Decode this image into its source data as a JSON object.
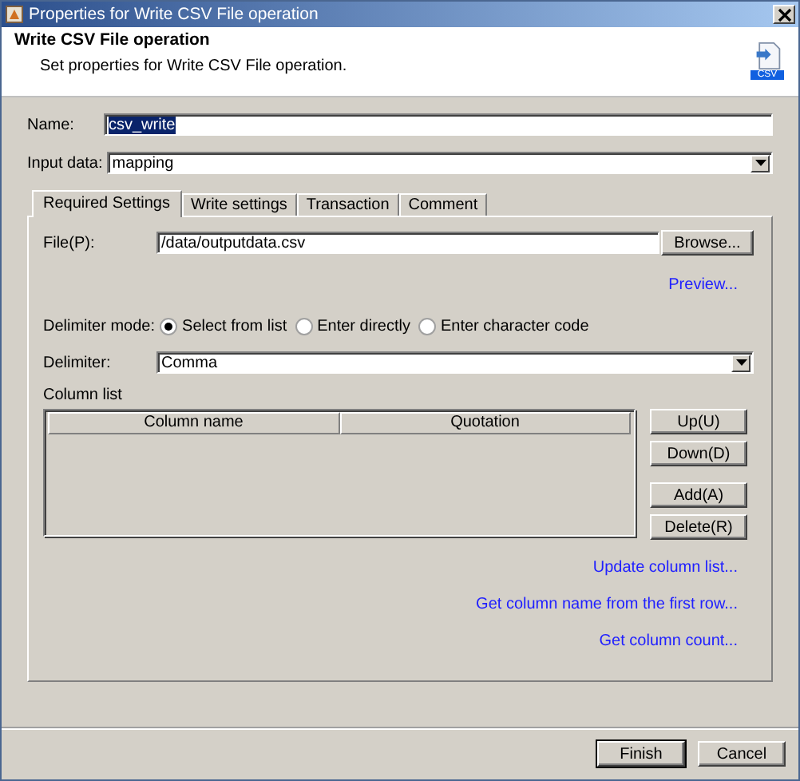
{
  "window": {
    "title": "Properties for Write CSV File operation"
  },
  "header": {
    "title": "Write CSV File operation",
    "description": "Set properties for Write CSV File operation.",
    "icon_label": "CSV"
  },
  "name_field": {
    "label": "Name:",
    "value": "csv_write",
    "text_selected": true
  },
  "input_data": {
    "label": "Input data:",
    "value": "mapping"
  },
  "tabs": [
    {
      "label": "Required Settings",
      "selected": true
    },
    {
      "label": "Write settings",
      "selected": false
    },
    {
      "label": "Transaction",
      "selected": false
    },
    {
      "label": "Comment",
      "selected": false
    }
  ],
  "file": {
    "label": "File(P):",
    "value": "/data/outputdata.csv",
    "button": "Browse..."
  },
  "preview_link": "Preview...",
  "delimiter_mode": {
    "label": "Delimiter mode:",
    "options": [
      {
        "label": "Select from list",
        "selected": true
      },
      {
        "label": "Enter directly",
        "selected": false
      },
      {
        "label": "Enter character code",
        "selected": false
      }
    ]
  },
  "delimiter": {
    "label": "Delimiter:",
    "value": "Comma"
  },
  "column_list": {
    "label": "Column list",
    "columns": [
      "Column name",
      "Quotation"
    ],
    "buttons": [
      "Up(U)",
      "Down(D)",
      "Add(A)",
      "Delete(R)"
    ]
  },
  "links": [
    "Update column list...",
    "Get column name from the first row...",
    "Get column count..."
  ],
  "buttons": [
    "Finish",
    "Cancel"
  ]
}
